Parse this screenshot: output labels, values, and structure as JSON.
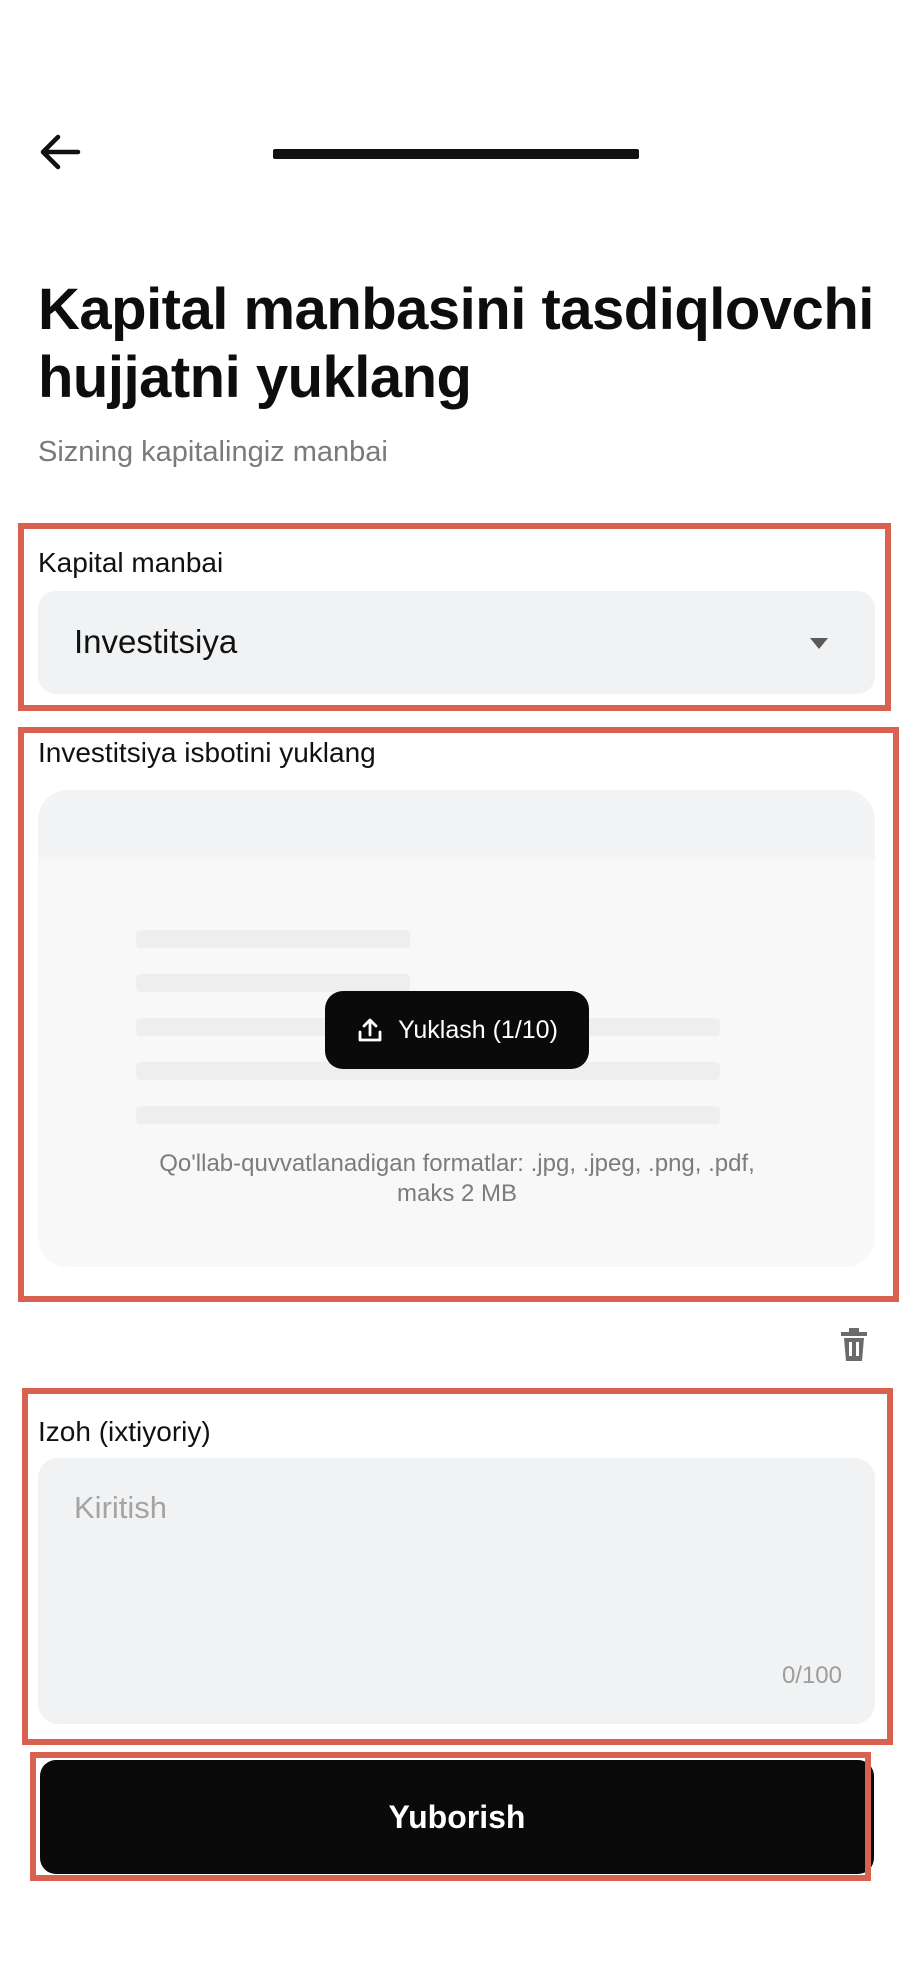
{
  "header": {
    "back_icon": "arrow-left-icon"
  },
  "page": {
    "title": "Kapital manbasini tasdiqlovchi hujjatni yuklang",
    "subtitle": "Sizning kapitalingiz manbai"
  },
  "capital_source": {
    "label": "Kapital manbai",
    "selected_value": "Investitsiya",
    "caret_icon": "caret-down-icon"
  },
  "upload": {
    "label": "Investitsiya isbotini yuklang",
    "button_label": "Yuklash (1/10)",
    "button_icon": "upload-icon",
    "formats_line1": "Qo'llab-quvvatlanadigan formatlar: .jpg, .jpeg, .png, .pdf,",
    "formats_line2": "maks 2 MB",
    "delete_icon": "trash-icon"
  },
  "comment": {
    "label": "Izoh (ixtiyoriy)",
    "placeholder": "Kiritish",
    "counter": "0/100"
  },
  "submit": {
    "label": "Yuborish"
  },
  "colors": {
    "highlight": "#d9614f",
    "button_bg": "#0a0a0a",
    "field_bg": "#f1f2f3"
  }
}
